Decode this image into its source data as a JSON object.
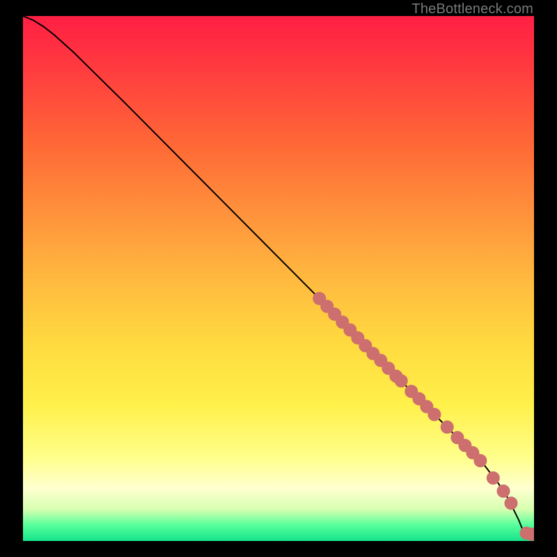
{
  "watermark": "TheBottleneck.com",
  "colors": {
    "curve": "#000000",
    "marker_fill": "#cc6f6e",
    "marker_stroke": "#cc6f6e"
  },
  "chart_data": {
    "type": "line",
    "title": "",
    "xlabel": "",
    "ylabel": "",
    "xlim": [
      0,
      100
    ],
    "ylim": [
      0,
      100
    ],
    "grid": false,
    "legend": false,
    "series": [
      {
        "name": "curve",
        "kind": "line",
        "x": [
          0,
          2,
          4,
          6,
          10,
          20,
          30,
          40,
          50,
          60,
          70,
          80,
          90,
          93,
          95,
          96,
          97,
          97.5,
          98,
          99,
          100
        ],
        "y": [
          100,
          99.2,
          98.0,
          96.5,
          93.0,
          83.4,
          73.6,
          63.8,
          54.0,
          44.2,
          34.4,
          24.6,
          14.8,
          11.0,
          8.0,
          6.0,
          4.0,
          2.8,
          1.8,
          1.3,
          1.2
        ]
      },
      {
        "name": "markers",
        "kind": "scatter",
        "x": [
          58,
          59.5,
          61,
          62.5,
          64,
          65.5,
          67,
          68.5,
          70,
          71.5,
          73,
          74,
          76,
          77.5,
          79,
          80.5,
          83,
          85,
          86.5,
          88,
          89.5,
          92,
          94,
          95.5,
          98.5,
          99.5
        ],
        "y": [
          46.2,
          44.7,
          43.2,
          41.7,
          40.2,
          38.7,
          37.2,
          35.7,
          34.4,
          32.9,
          31.4,
          30.5,
          28.5,
          27.1,
          25.6,
          24.1,
          21.7,
          19.7,
          18.2,
          16.8,
          15.3,
          12.0,
          9.5,
          7.2,
          1.5,
          1.3
        ]
      }
    ]
  }
}
